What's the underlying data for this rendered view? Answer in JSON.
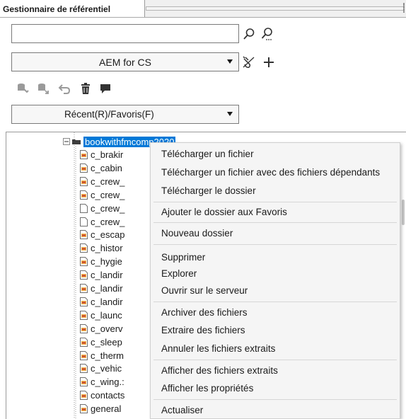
{
  "panel": {
    "tab_title": "Gestionnaire de référentiel"
  },
  "search": {
    "value": "",
    "placeholder": ""
  },
  "icons": {
    "search": "magnifier-icon",
    "advanced_search": "magnifier-dots-icon",
    "disconnect": "disconnect-plug-icon",
    "add": "plus-icon",
    "toolbar": [
      "checkin-icon",
      "checkout-icon",
      "undo-icon",
      "trash-icon",
      "comment-icon"
    ]
  },
  "connection": {
    "selected": "AEM for CS"
  },
  "filter": {
    "selected": "Récent(R)/Favoris(F)"
  },
  "tree": {
    "folder": "bookwithfmcomp2020",
    "items": [
      {
        "label": "c_brakir",
        "kind": "map"
      },
      {
        "label": "c_cabin",
        "kind": "map"
      },
      {
        "label": "c_crew_",
        "kind": "map"
      },
      {
        "label": "c_crew_",
        "kind": "map"
      },
      {
        "label": "c_crew_",
        "kind": "plain"
      },
      {
        "label": "c_crew_",
        "kind": "plain"
      },
      {
        "label": "c_escap",
        "kind": "map"
      },
      {
        "label": "c_histor",
        "kind": "map"
      },
      {
        "label": "c_hygie",
        "kind": "map"
      },
      {
        "label": "c_landir",
        "kind": "map"
      },
      {
        "label": "c_landir",
        "kind": "map"
      },
      {
        "label": "c_landir",
        "kind": "map"
      },
      {
        "label": "c_launc",
        "kind": "map"
      },
      {
        "label": "c_overv",
        "kind": "map"
      },
      {
        "label": "c_sleep",
        "kind": "map"
      },
      {
        "label": "c_therm",
        "kind": "map"
      },
      {
        "label": "c_vehic",
        "kind": "map"
      },
      {
        "label": "c_wing.:",
        "kind": "map"
      },
      {
        "label": "contacts",
        "kind": "map"
      },
      {
        "label": "general",
        "kind": "map"
      }
    ]
  },
  "context_menu": {
    "items": [
      "Télécharger un fichier",
      "Télécharger un fichier avec des fichiers dépendants",
      "Télécharger le dossier",
      "Ajouter le dossier aux Favoris",
      "Nouveau dossier",
      "Supprimer",
      "Explorer",
      "Ouvrir sur le serveur",
      "Archiver des fichiers",
      "Extraire des fichiers",
      "Annuler les fichiers extraits",
      "Afficher des fichiers extraits",
      "Afficher les propriétés",
      "Actualiser"
    ]
  },
  "colors": {
    "selection": "#0078d7",
    "toolbar_disabled": "#9a9a9a",
    "menu_bg": "#f5f5f5"
  }
}
